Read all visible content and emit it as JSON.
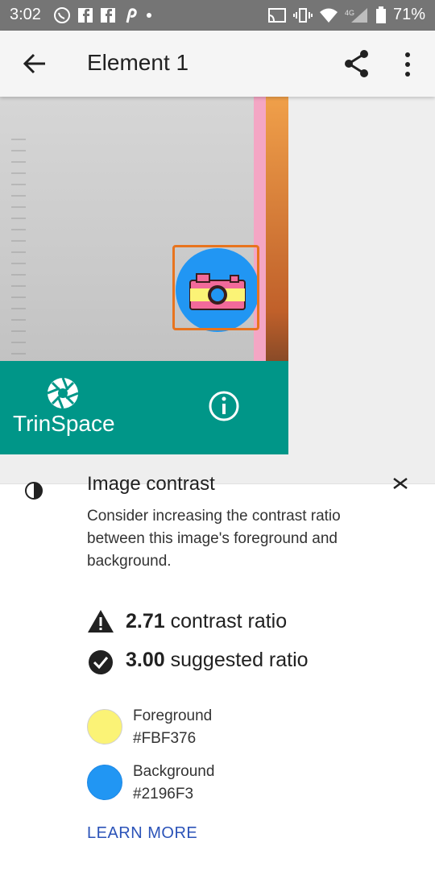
{
  "status_bar": {
    "time": "3:02",
    "battery": "71%",
    "network": "4G"
  },
  "app_bar": {
    "title": "Element 1"
  },
  "preview": {
    "brand_text": "TrinSpace"
  },
  "sheet": {
    "heading": "Image contrast",
    "description": "Consider increasing the contrast ratio between this image's foreground and background.",
    "contrast_value": "2.71",
    "contrast_label": " contrast ratio",
    "suggested_value": "3.00",
    "suggested_label": " suggested ratio",
    "foreground_label": "Foreground",
    "foreground_hex": "#FBF376",
    "background_label": "Background",
    "background_hex": "#2196F3",
    "learn_more": "LEARN MORE"
  },
  "colors": {
    "foreground": "#FBF376",
    "background": "#2196F3",
    "teal": "#009688",
    "highlight": "#e8741e",
    "link": "#2b53b8"
  }
}
